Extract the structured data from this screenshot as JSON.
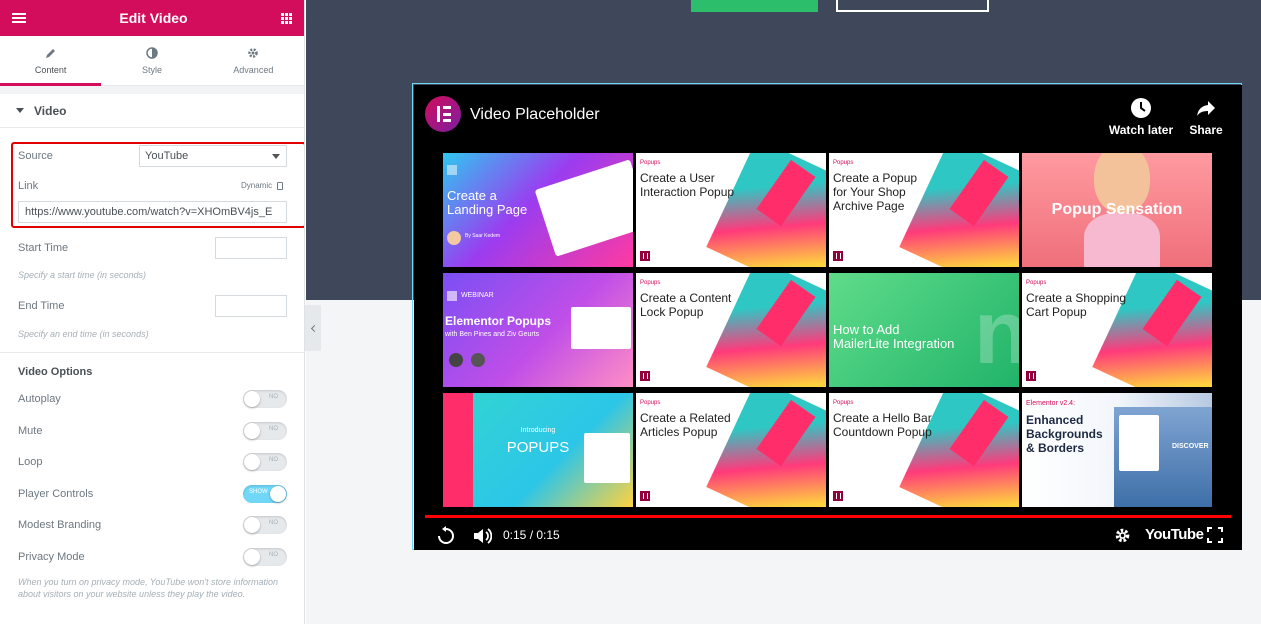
{
  "sidebar": {
    "title": "Edit Video",
    "tabs": [
      {
        "label": "Content",
        "active": true
      },
      {
        "label": "Style",
        "active": false
      },
      {
        "label": "Advanced",
        "active": false
      }
    ],
    "section_title": "Video",
    "source": {
      "label": "Source",
      "value": "YouTube"
    },
    "link": {
      "label": "Link",
      "dynamic_label": "Dynamic",
      "value": "https://www.youtube.com/watch?v=XHOmBV4js_E"
    },
    "start_time": {
      "label": "Start Time",
      "value": "",
      "hint": "Specify a start time (in seconds)"
    },
    "end_time": {
      "label": "End Time",
      "value": "",
      "hint": "Specify an end time (in seconds)"
    },
    "video_options_title": "Video Options",
    "options": [
      {
        "label": "Autoplay",
        "state": "NO",
        "on": false
      },
      {
        "label": "Mute",
        "state": "NO",
        "on": false
      },
      {
        "label": "Loop",
        "state": "NO",
        "on": false
      },
      {
        "label": "Player Controls",
        "state": "SHOW",
        "on": true
      },
      {
        "label": "Modest Branding",
        "state": "NO",
        "on": false
      },
      {
        "label": "Privacy Mode",
        "state": "NO",
        "on": false
      }
    ],
    "privacy_note": "When you turn on privacy mode, YouTube won't store information about visitors on your website unless they play the video."
  },
  "video": {
    "title": "Video Placeholder",
    "watch_later": "Watch later",
    "share": "Share",
    "time": "0:15 / 0:15",
    "brand": "YouTube",
    "progress": 1.0,
    "cards": [
      {
        "tag": "",
        "title": "Create a\nLanding Page",
        "style": "landing",
        "sub": "By Saar Kedem"
      },
      {
        "tag": "Popups",
        "title": "Create a User\nInteraction Popup",
        "style": "popup"
      },
      {
        "tag": "Popups",
        "title": "Create a Popup\nfor Your Shop\nArchive Page",
        "style": "popup"
      },
      {
        "tag": "",
        "title": "Popup Sensation",
        "style": "sensation"
      },
      {
        "tag": "WEBINAR",
        "title": "Elementor Popups",
        "style": "webinar",
        "sub": "with Ben Pines and Ziv Geurts"
      },
      {
        "tag": "Popups",
        "title": "Create a Content\nLock Popup",
        "style": "popup"
      },
      {
        "tag": "",
        "title": "How to Add\nMailerLite Integration",
        "style": "green"
      },
      {
        "tag": "Popups",
        "title": "Create a Shopping\nCart Popup",
        "style": "popup"
      },
      {
        "tag": "Introducing",
        "title": "POPUPS",
        "style": "popups"
      },
      {
        "tag": "Popups",
        "title": "Create a Related\nArticles Popup",
        "style": "popup"
      },
      {
        "tag": "Popups",
        "title": "Create a Hello Bar\nCountdown Popup",
        "style": "popup"
      },
      {
        "tag": "Elementor v2.4:",
        "title": "Enhanced\nBackgrounds\n& Borders",
        "style": "backgrounds",
        "sub": "DISCOVER"
      }
    ]
  },
  "colors": {
    "brand": "#d30c5c",
    "canvas_dark": "#3e485a",
    "accent_on": "#71d7f7",
    "highlight": "#e00000",
    "progress": "#ff0000"
  }
}
